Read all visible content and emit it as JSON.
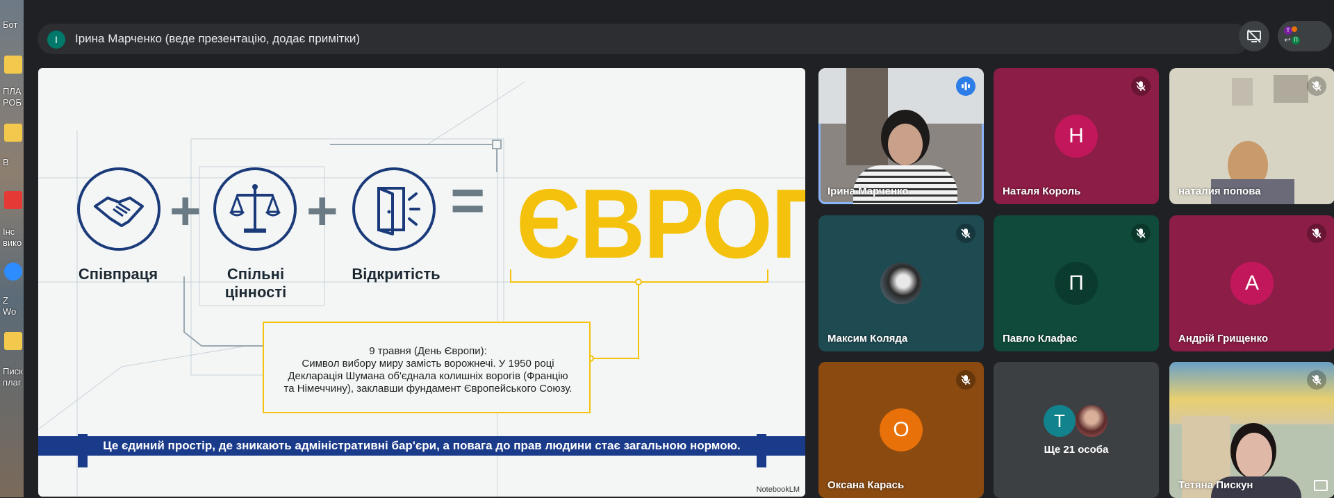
{
  "desktop": {
    "labels": [
      "Бот",
      "ПЛА",
      "РОБ",
      "В",
      "Інс",
      "вико",
      "Z",
      "Wo",
      "Писк",
      "плаг"
    ]
  },
  "meet": {
    "presenter_initial": "І",
    "presenter_text": "Ірина Марченко (веде презентацію, додає примітки)",
    "people_initials": [
      "Т",
      "П"
    ]
  },
  "slide": {
    "captions": [
      "Співпраця",
      "Спільні\nцінності",
      "Відкритість"
    ],
    "plus": "+",
    "equals": "=",
    "headline": "ЄВРОПА",
    "note": "9 травня (День Європи):\nСимвол вибору миру замість ворожнечі. У 1950 році\nДекларація Шумана об'єднала колишніх ворогів (Францію\nта Німеччину), заклавши фундамент Європейського Союзу.",
    "banner": "Це єдиний простір, де зникають адміністративні бар'єри, а повага до прав людини стає загальною нормою.",
    "watermark": "NotebookLM",
    "colors": {
      "navy": "#1a3a7a",
      "yellow": "#f4c20d",
      "banner": "#1a3a8a"
    }
  },
  "tiles": [
    {
      "name": "Ірина Марченко",
      "kind": "video",
      "speaking": true
    },
    {
      "name": "Наталя Король",
      "kind": "avatar",
      "initial": "Н",
      "bg": "#8c1d46",
      "avatar": "#c2185b",
      "muted": true
    },
    {
      "name": "наталия попова",
      "kind": "video",
      "muted": true
    },
    {
      "name": "Максим Коляда",
      "kind": "photo",
      "bg": "#1e4a52",
      "muted": true
    },
    {
      "name": "Павло Клафас",
      "kind": "avatar",
      "initial": "П",
      "bg": "#0f4a3a",
      "avatar": "#0b3a2e",
      "muted": true
    },
    {
      "name": "Андрій Грищенко",
      "kind": "avatar",
      "initial": "А",
      "bg": "#8c1d46",
      "avatar": "#c2185b",
      "muted": true
    },
    {
      "name": "Оксана Карась",
      "kind": "avatar",
      "initial": "О",
      "bg": "#8a4a10",
      "avatar": "#e8710a",
      "muted": true
    },
    {
      "name": "Ще 21 особа",
      "kind": "more",
      "initial": "Т",
      "bg": "#3c4043"
    },
    {
      "name": "Тетяна Пискун",
      "kind": "video",
      "muted": true
    }
  ]
}
